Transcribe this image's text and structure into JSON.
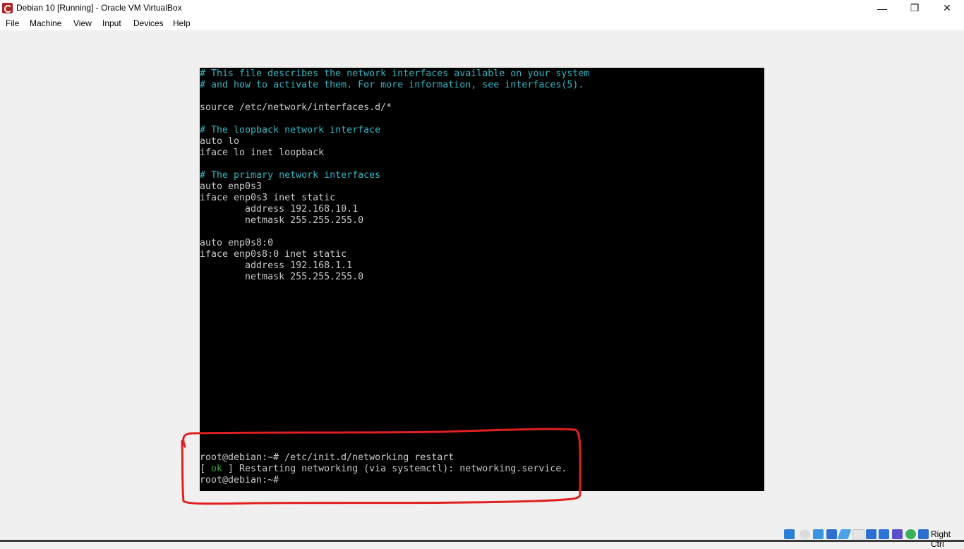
{
  "window": {
    "title": "Debian 10 [Running] - Oracle VM VirtualBox",
    "app_icon": "virtualbox-debian-icon",
    "controls": {
      "minimize": "—",
      "restore": "❐",
      "close": "✕"
    }
  },
  "menubar": {
    "items": [
      {
        "label": "File"
      },
      {
        "label": "Machine"
      },
      {
        "label": "View"
      },
      {
        "label": "Input"
      },
      {
        "label": "Devices"
      },
      {
        "label": "Help"
      }
    ]
  },
  "console": {
    "lines": [
      {
        "text": "# This file describes the network interfaces available on your system",
        "type": "comment"
      },
      {
        "text": "# and how to activate them. For more information, see interfaces(5).",
        "type": "comment"
      },
      {
        "text": "",
        "type": "blank"
      },
      {
        "text": "source /etc/network/interfaces.d/*",
        "type": "code"
      },
      {
        "text": "",
        "type": "blank"
      },
      {
        "text": "# The loopback network interface",
        "type": "comment"
      },
      {
        "text": "auto lo",
        "type": "code"
      },
      {
        "text": "iface lo inet loopback",
        "type": "code"
      },
      {
        "text": "",
        "type": "blank"
      },
      {
        "text": "# The primary network interfaces",
        "type": "comment"
      },
      {
        "text": "auto enp0s3",
        "type": "code"
      },
      {
        "text": "iface enp0s3 inet static",
        "type": "code"
      },
      {
        "text": "        address 192.168.10.1",
        "type": "code"
      },
      {
        "text": "        netmask 255.255.255.0",
        "type": "code"
      },
      {
        "text": "",
        "type": "blank"
      },
      {
        "text": "auto enp0s8:0",
        "type": "code"
      },
      {
        "text": "iface enp0s8:0 inet static",
        "type": "code"
      },
      {
        "text": "        address 192.168.1.1",
        "type": "code"
      },
      {
        "text": "        netmask 255.255.255.0",
        "type": "code"
      }
    ],
    "prompt_lines": {
      "command": "root@debian:~# /etc/init.d/networking restart",
      "status_open": "[ ",
      "status_ok": "ok",
      "status_close": " ] Restarting networking (via systemctl): networking.service.",
      "prompt": "root@debian:~#"
    }
  },
  "annotation": {
    "color": "#e02020",
    "description": "red hand-drawn box around command output"
  },
  "statusbar": {
    "icons": [
      "hard-disk-icon",
      "optical-drive-icon",
      "audio-icon",
      "network-icon",
      "usb-icon",
      "shared-folders-icon",
      "display-icon",
      "video-capture-icon",
      "cpu-virtualization-icon",
      "mouse-integration-icon",
      "keyboard-capture-icon"
    ],
    "host_key": "Right Ctrl"
  }
}
